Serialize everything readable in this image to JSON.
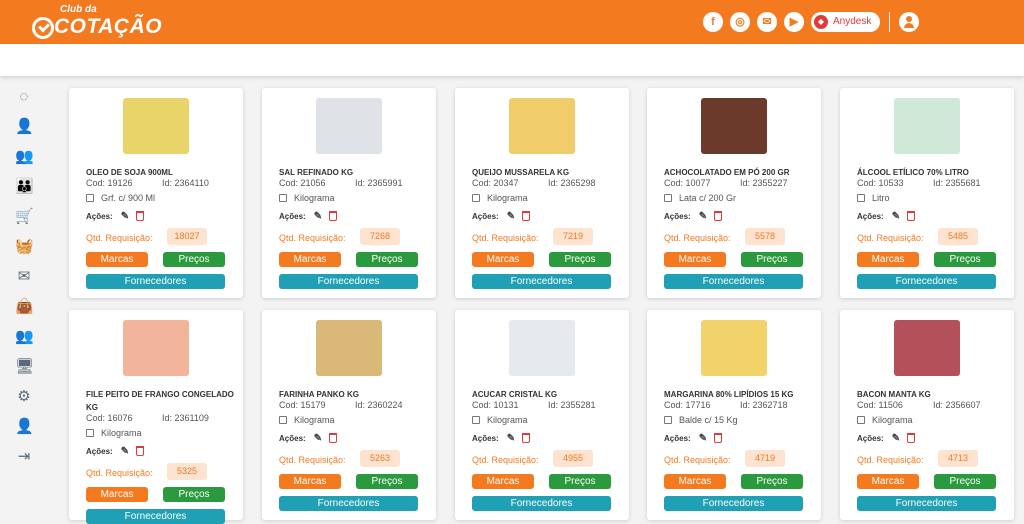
{
  "header": {
    "logo_top": "Club da",
    "logo_main": "COTAÇÃO",
    "social": [
      {
        "name": "facebook-icon",
        "glyph": "f"
      },
      {
        "name": "instagram-icon",
        "glyph": "◎"
      },
      {
        "name": "email-icon",
        "glyph": "✉"
      },
      {
        "name": "youtube-icon",
        "glyph": "▶"
      }
    ],
    "anydesk_label": "Anydesk",
    "accent": "#f47a20"
  },
  "sidebar": {
    "items": [
      {
        "name": "sidebar-item-dashboard",
        "glyph": "◌",
        "active": false
      },
      {
        "name": "sidebar-item-user",
        "glyph": "👤",
        "active": false
      },
      {
        "name": "sidebar-item-users",
        "glyph": "👥",
        "active": false
      },
      {
        "name": "sidebar-item-groups",
        "glyph": "👪",
        "active": false
      },
      {
        "name": "sidebar-item-cart",
        "glyph": "🛒",
        "active": true
      },
      {
        "name": "sidebar-item-basket",
        "glyph": "🧺",
        "active": false
      },
      {
        "name": "sidebar-item-messages",
        "glyph": "✉",
        "active": false
      },
      {
        "name": "sidebar-item-bag",
        "glyph": "👜",
        "active": false
      },
      {
        "name": "sidebar-item-supplier",
        "glyph": "👥",
        "active": false
      },
      {
        "name": "sidebar-item-monitor",
        "glyph": "🖥",
        "active": false
      },
      {
        "name": "sidebar-item-settings",
        "glyph": "⚙",
        "active": false
      },
      {
        "name": "sidebar-item-user-settings",
        "glyph": "👤",
        "active": false
      },
      {
        "name": "sidebar-item-logout",
        "glyph": "⇥",
        "active": false
      }
    ]
  },
  "labels": {
    "acoes": "Ações:",
    "qtd": "Qtd. Requisição:",
    "marcas": "Marcas",
    "precos": "Preços",
    "fornecedores": "Fornecedores"
  },
  "products": [
    {
      "name": "OLEO DE SOJA 900ML",
      "cod": "Cod: 19126",
      "id": "Id: 2364110",
      "unit": "Grf. c/ 900 Ml",
      "qtd": "18027",
      "img_color": "#e9d46a"
    },
    {
      "name": "SAL REFINADO KG",
      "cod": "Cod: 21056",
      "id": "Id: 2365991",
      "unit": "Kilograma",
      "qtd": "7268",
      "img_color": "#dfe3e8"
    },
    {
      "name": "QUEIJO MUSSARELA KG",
      "cod": "Cod: 20347",
      "id": "Id: 2365298",
      "unit": "Kilograma",
      "qtd": "7219",
      "img_color": "#f0cd6a"
    },
    {
      "name": "ACHOCOLATADO EM PÓ 200 GR",
      "cod": "Cod: 10077",
      "id": "Id: 2355227",
      "unit": "Lata c/ 200 Gr",
      "qtd": "5578",
      "img_color": "#6b3a2a"
    },
    {
      "name": "ÁLCOOL ETÍLICO 70% LITRO",
      "cod": "Cod: 10533",
      "id": "Id: 2355681",
      "unit": "Litro",
      "qtd": "5485",
      "img_color": "#cfe8d8"
    },
    {
      "name": "FILE PEITO DE FRANGO CONGELADO KG",
      "cod": "Cod: 16076",
      "id": "Id: 2361109",
      "unit": "Kilograma",
      "qtd": "5325",
      "img_color": "#f2b49a"
    },
    {
      "name": "FARINHA PANKO KG",
      "cod": "Cod: 15179",
      "id": "Id: 2360224",
      "unit": "Kilograma",
      "qtd": "5263",
      "img_color": "#d9b878"
    },
    {
      "name": "ACUCAR CRISTAL KG",
      "cod": "Cod: 10131",
      "id": "Id: 2355281",
      "unit": "Kilograma",
      "qtd": "4955",
      "img_color": "#e6eaee"
    },
    {
      "name": "MARGARINA 80% LIPÍDIOS 15 KG",
      "cod": "Cod: 17716",
      "id": "Id: 2362718",
      "unit": "Balde c/ 15 Kg",
      "qtd": "4719",
      "img_color": "#f2d36a"
    },
    {
      "name": "BACON MANTA KG",
      "cod": "Cod: 11506",
      "id": "Id: 2356607",
      "unit": "Kilograma",
      "qtd": "4713",
      "img_color": "#b4505a"
    }
  ]
}
